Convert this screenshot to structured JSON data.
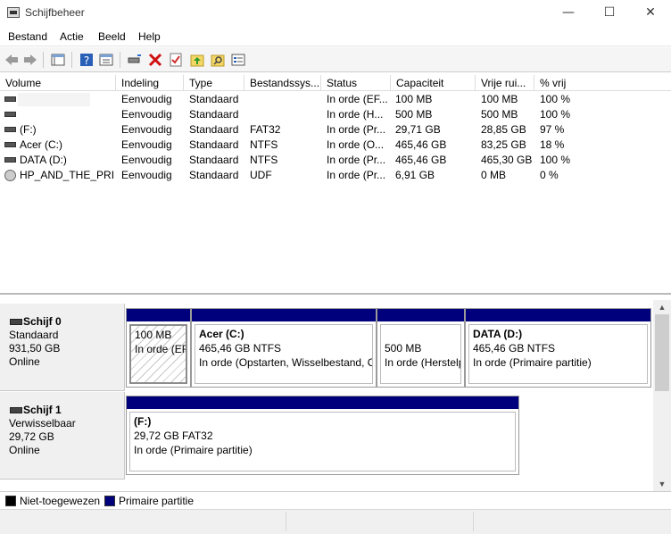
{
  "window": {
    "title": "Schijfbeheer",
    "minimize": "—",
    "maximize": "☐",
    "close": "✕"
  },
  "menu": [
    "Bestand",
    "Actie",
    "Beeld",
    "Help"
  ],
  "toolbar": {
    "icons": [
      "back-icon",
      "forward-icon",
      "list-view-icon",
      "help-icon",
      "properties-icon",
      "connect-drive-icon",
      "delete-icon",
      "check-icon",
      "folder-up-icon",
      "folder-search-icon",
      "options-icon"
    ]
  },
  "table": {
    "columns": [
      "Volume",
      "Indeling",
      "Type",
      "Bestandssys...",
      "Status",
      "Capaciteit",
      "Vrije rui...",
      "% vrij"
    ],
    "rows": [
      {
        "volume": "",
        "layout": "Eenvoudig",
        "type": "Standaard",
        "fs": "",
        "status": "In orde (EF...",
        "capacity": "100 MB",
        "free": "100 MB",
        "pct": "100 %",
        "icon": "volume-icon"
      },
      {
        "volume": "",
        "layout": "Eenvoudig",
        "type": "Standaard",
        "fs": "",
        "status": "In orde (H...",
        "capacity": "500 MB",
        "free": "500 MB",
        "pct": "100 %",
        "icon": "volume-icon"
      },
      {
        "volume": "(F:)",
        "layout": "Eenvoudig",
        "type": "Standaard",
        "fs": "FAT32",
        "status": "In orde (Pr...",
        "capacity": "29,71 GB",
        "free": "28,85 GB",
        "pct": "97 %",
        "icon": "volume-icon"
      },
      {
        "volume": "Acer (C:)",
        "layout": "Eenvoudig",
        "type": "Standaard",
        "fs": "NTFS",
        "status": "In orde (O...",
        "capacity": "465,46 GB",
        "free": "83,25 GB",
        "pct": "18 %",
        "icon": "volume-icon"
      },
      {
        "volume": "DATA (D:)",
        "layout": "Eenvoudig",
        "type": "Standaard",
        "fs": "NTFS",
        "status": "In orde (Pr...",
        "capacity": "465,46 GB",
        "free": "465,30 GB",
        "pct": "100 %",
        "icon": "volume-icon"
      },
      {
        "volume": "HP_AND_THE_PRI...",
        "layout": "Eenvoudig",
        "type": "Standaard",
        "fs": "UDF",
        "status": "In orde (Pr...",
        "capacity": "6,91 GB",
        "free": "0 MB",
        "pct": "0 %",
        "icon": "disc-icon"
      }
    ]
  },
  "disks": [
    {
      "name": "Schijf 0",
      "kind": "Standaard",
      "size": "931,50 GB",
      "state": "Online",
      "partitions": [
        {
          "title": "",
          "size": "100 MB",
          "status": "In orde (EFI-systeempartitie)"
        },
        {
          "title": "Acer  (C:)",
          "size": "465,46 GB NTFS",
          "status": "In orde (Opstarten, Wisselbestand, C"
        },
        {
          "title": "",
          "size": "500 MB",
          "status": "In orde (Herstelpartitie)"
        },
        {
          "title": "DATA  (D:)",
          "size": "465,46 GB NTFS",
          "status": "In orde (Primaire partitie)"
        }
      ]
    },
    {
      "name": "Schijf 1",
      "kind": "Verwisselbaar",
      "size": "29,72 GB",
      "state": "Online",
      "partitions": [
        {
          "title": "(F:)",
          "size": "29,72 GB FAT32",
          "status": "In orde (Primaire partitie)"
        }
      ]
    }
  ],
  "legend": [
    {
      "label": "Niet-toegewezen",
      "color": "#000000"
    },
    {
      "label": "Primaire partitie",
      "color": "#00007c"
    }
  ],
  "colors": {
    "primary_partition": "#00007c",
    "unallocated": "#000000"
  }
}
